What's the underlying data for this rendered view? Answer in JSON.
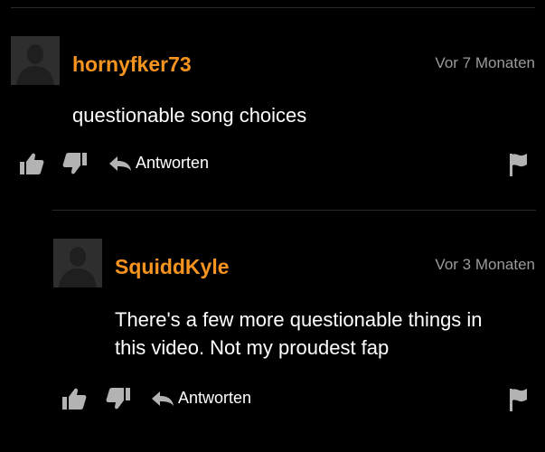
{
  "theme": {
    "background": "#000000",
    "accent": "#f79420",
    "text": "#ffffff",
    "muted": "#9a9a9a",
    "icon": "#b3b3b3",
    "divider": "#2a2a2a"
  },
  "comments": [
    {
      "username": "hornyfker73",
      "timestamp": "Vor 7 Monaten",
      "text_lines": [
        "questionable song choices"
      ],
      "reply_label": "Antworten",
      "icons": {
        "like": "thumbs-up-icon",
        "dislike": "thumbs-down-icon",
        "reply": "reply-arrow-icon",
        "flag": "flag-icon"
      }
    },
    {
      "username": "SquiddKyle",
      "timestamp": "Vor 3 Monaten",
      "text_lines": [
        "There's a few more questionable things in",
        "this video. Not my proudest fap"
      ],
      "reply_label": "Antworten",
      "icons": {
        "like": "thumbs-up-icon",
        "dislike": "thumbs-down-icon",
        "reply": "reply-arrow-icon",
        "flag": "flag-icon"
      }
    }
  ]
}
